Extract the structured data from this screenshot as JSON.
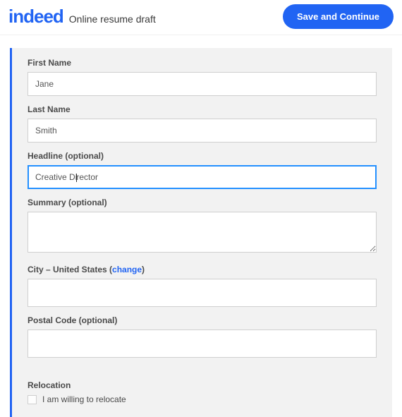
{
  "header": {
    "logo_text": "indeed",
    "subtitle": "Online resume draft",
    "save_label": "Save and Continue"
  },
  "form": {
    "first_name": {
      "label": "First Name",
      "value": "Jane"
    },
    "last_name": {
      "label": "Last Name",
      "value": "Smith"
    },
    "headline": {
      "label": "Headline (optional)",
      "value_left": "Creative Di",
      "value_right": "rector",
      "value": "Creative Director"
    },
    "summary": {
      "label": "Summary (optional)",
      "value": ""
    },
    "city": {
      "label_prefix": "City – United States (",
      "change_link": "change",
      "label_suffix": ")",
      "value": ""
    },
    "postal": {
      "label": "Postal Code (optional)",
      "value": ""
    },
    "relocation": {
      "label": "Relocation",
      "checkbox_label": "I am willing to relocate",
      "checked": false
    }
  }
}
